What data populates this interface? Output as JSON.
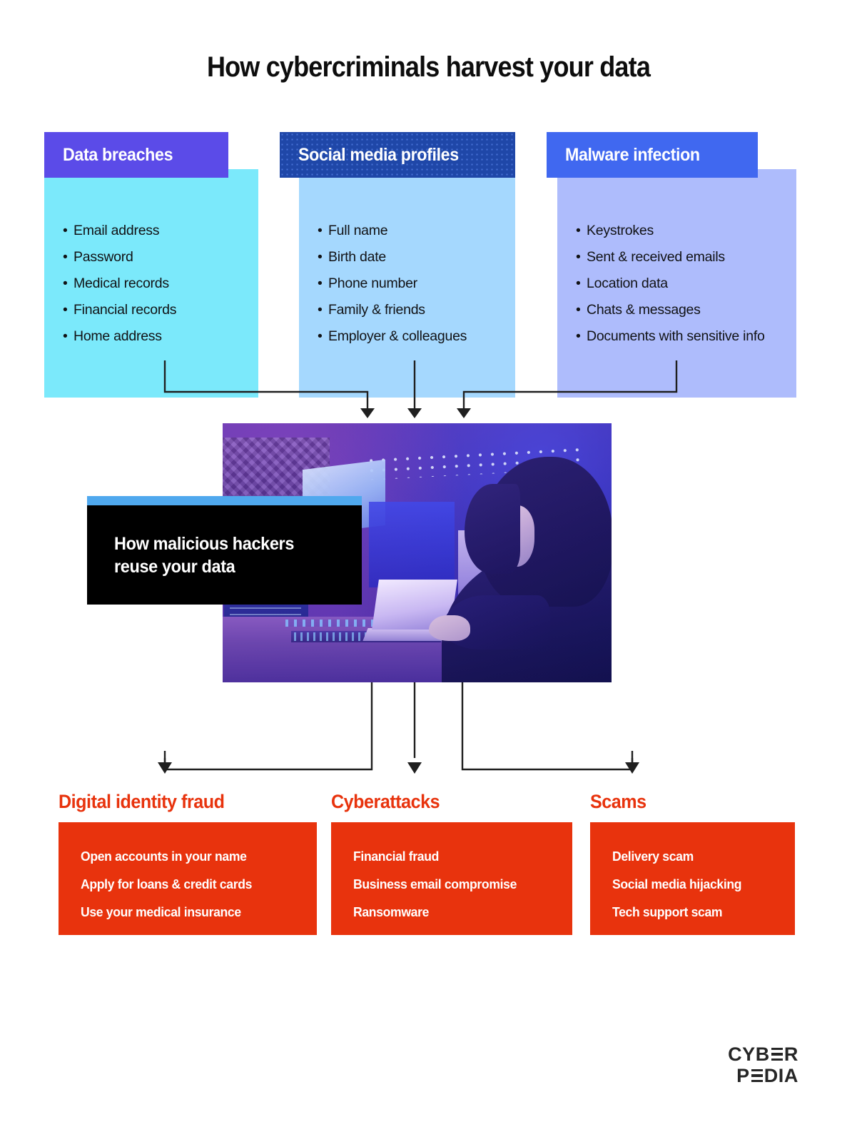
{
  "title": "How cybercriminals harvest your data",
  "sources": [
    {
      "id": "data-breaches",
      "title": "Data breaches",
      "header_color": "#5B4BE8",
      "body_color": "#7BE9FB",
      "items": [
        "Email address",
        "Password",
        "Medical records",
        "Financial records",
        "Home address"
      ]
    },
    {
      "id": "social-media-profiles",
      "title": "Social media profiles",
      "header_color": "#1F47A8",
      "body_color": "#A5D8FE",
      "items": [
        "Full name",
        "Birth date",
        "Phone number",
        "Family & friends",
        "Employer & colleagues"
      ]
    },
    {
      "id": "malware-infection",
      "title": "Malware infection",
      "header_color": "#4068F0",
      "body_color": "#AEBCFC",
      "items": [
        "Keystrokes",
        "Sent & received emails",
        "Location data",
        "Chats & messages",
        "Documents with sensitive info"
      ]
    }
  ],
  "hero": {
    "caption": "How malicious hackers\nreuse your data",
    "strip_color": "#4FA8EE",
    "caption_bg": "#000000",
    "image_alt": "hooded hacker at a desk lit by blue and purple light"
  },
  "outcomes": [
    {
      "id": "digital-identity-fraud",
      "title": "Digital identity fraud",
      "color": "#E8330D",
      "items": [
        "Open accounts in your name",
        "Apply for loans & credit cards",
        "Use your medical insurance"
      ]
    },
    {
      "id": "cyberattacks",
      "title": "Cyberattacks",
      "color": "#E8330D",
      "items": [
        "Financial fraud",
        "Business email compromise",
        "Ransomware"
      ]
    },
    {
      "id": "scams",
      "title": "Scams",
      "color": "#E8330D",
      "items": [
        "Delivery scam",
        "Social media hijacking",
        "Tech support scam"
      ]
    }
  ],
  "logo": {
    "line1_a": "CYB",
    "line1_e": "E",
    "line1_b": "R",
    "line2_a": "P",
    "line2_e": "E",
    "line2_b": "DIA"
  },
  "connector_color": "#1F1F1F"
}
